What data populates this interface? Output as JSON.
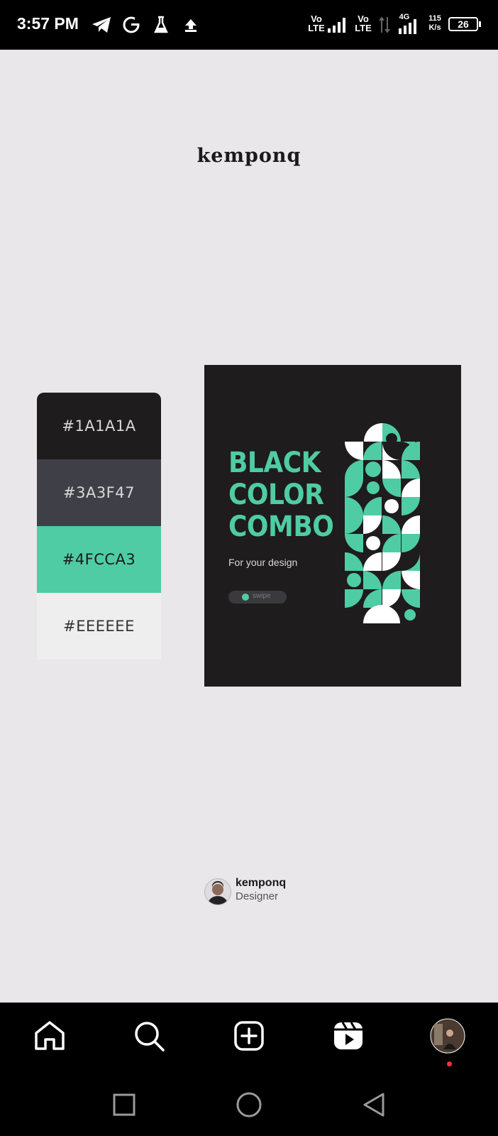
{
  "status_bar": {
    "time": "3:57 PM",
    "net1": "Vo\nLTE",
    "net2": "Vo\nLTE",
    "net3": "4G",
    "speed_value": "115",
    "speed_unit": "K/s",
    "battery": "26"
  },
  "post": {
    "brand": "kemponq",
    "palette": [
      {
        "hex": "#1A1A1A",
        "color": "#1e1c1d",
        "text_color": "#d8d8d8"
      },
      {
        "hex": "#3A3F47",
        "color": "#3f3f47",
        "text_color": "#d8d8d8"
      },
      {
        "hex": "#4FCCA3",
        "color": "#4fcca3",
        "text_color": "#1a1a1a"
      },
      {
        "hex": "#EEEEEE",
        "color": "#eeeeee",
        "text_color": "#333333"
      }
    ],
    "poster": {
      "title_lines": [
        "BLACK",
        "COLOR",
        "COMBO"
      ],
      "subtitle": "For your design",
      "pill": "swipe",
      "accent": "#4fcca3",
      "background": "#1e1c1d"
    },
    "author": {
      "name": "kemponq",
      "role": "Designer"
    }
  },
  "bottom_nav": {
    "items": [
      "home-icon",
      "search-icon",
      "create-icon",
      "reels-icon",
      "profile-avatar"
    ]
  },
  "system_nav": {
    "items": [
      "recents-button",
      "home-button",
      "back-button"
    ]
  }
}
